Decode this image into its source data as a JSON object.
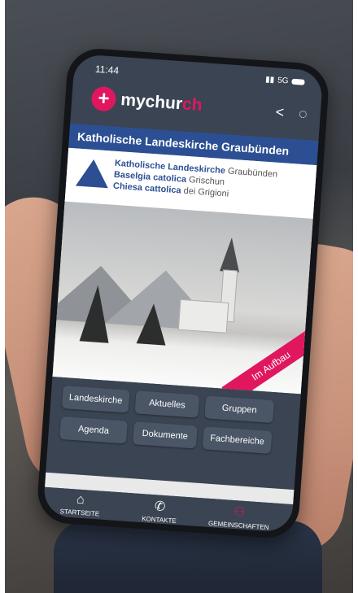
{
  "status": {
    "time": "11:44",
    "network": "5G"
  },
  "app": {
    "logo_plus": "+",
    "logo_prefix": "mychur",
    "logo_suffix": "ch",
    "share_glyph": "<",
    "chat_glyph": "◌"
  },
  "page_title": "Katholische Landeskirche Graubünden",
  "brand": {
    "line1_bold": "Katholische Landeskirche",
    "line1_rest": "Graubünden",
    "line2_bold": "Baselgia catolica",
    "line2_rest": "Grischun",
    "line3_bold": "Chiesa cattolica",
    "line3_rest": "dei Grigioni"
  },
  "banner": "Im Aufbau",
  "buttons": {
    "landeskirche": "Landeskirche",
    "aktuelles": "Aktuelles",
    "gruppen": "Gruppen",
    "agenda": "Agenda",
    "dokumente": "Dokumente",
    "fachbereiche": "Fachbereiche"
  },
  "tabs": {
    "startseite": {
      "label": "STARTSEITE",
      "icon": "⌂"
    },
    "kontakte": {
      "label": "KONTAKTE",
      "icon": "✆"
    },
    "gemeinschaften": {
      "label": "GEMEINSCHAFTEN",
      "icon": "⚇"
    }
  },
  "colors": {
    "brand_pink": "#e0175f",
    "brand_blue": "#2c4f93",
    "app_bg": "#3b4452"
  }
}
